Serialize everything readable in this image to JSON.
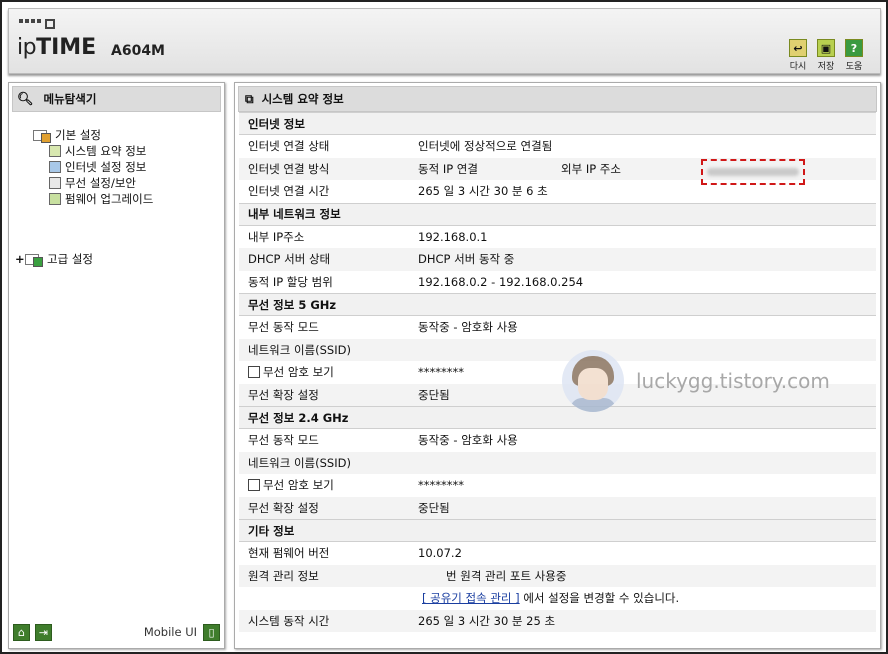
{
  "header": {
    "brand_prefix": "ip",
    "brand_main": "TIME",
    "model": "A604M",
    "tools": [
      {
        "label": "다시",
        "icon": "refresh-icon",
        "color": "#e0d070"
      },
      {
        "label": "저장",
        "icon": "save-icon",
        "color": "#b8d050"
      },
      {
        "label": "도움",
        "icon": "help-icon",
        "color": "#3a9a40"
      }
    ]
  },
  "sidebar": {
    "title": "메뉴탐색기",
    "basic": {
      "label": "기본 설정",
      "items": [
        {
          "label": "시스템 요약 정보",
          "icon": "chart-icon"
        },
        {
          "label": "인터넷 설정 정보",
          "icon": "monitor-icon"
        },
        {
          "label": "무선 설정/보안",
          "icon": "wireless-icon"
        },
        {
          "label": "펌웨어 업그레이드",
          "icon": "upgrade-icon"
        }
      ]
    },
    "advanced": {
      "expander": "+",
      "label": "고급 설정"
    },
    "footer": {
      "mobile_label": "Mobile UI"
    }
  },
  "main": {
    "title": "시스템 요약 정보",
    "internet": {
      "heading": "인터넷 정보",
      "status_label": "인터넷 연결 상태",
      "status_value": "인터넷에 정상적으로 연결됨",
      "method_label": "인터넷 연결 방식",
      "method_value": "동적 IP 연결",
      "external_ip_label": "외부 IP 주소",
      "uptime_label": "인터넷 연결 시간",
      "uptime_value": "265 일 3 시간 30 분 6 초"
    },
    "lan": {
      "heading": "내부 네트워크 정보",
      "ip_label": "내부 IP주소",
      "ip_value": "192.168.0.1",
      "dhcp_label": "DHCP 서버 상태",
      "dhcp_value": "DHCP 서버 동작 중",
      "range_label": "동적 IP 할당 범위",
      "range_value": "192.168.0.2 -  192.168.0.254"
    },
    "wifi5": {
      "heading": "무선 정보 5 GHz",
      "mode_label": "무선 동작 모드",
      "mode_value": "동작중 - 암호화 사용",
      "ssid_label": "네트워크 이름(SSID)",
      "pw_label": "무선 암호 보기",
      "pw_value": "********",
      "ext_label": "무선 확장 설정",
      "ext_value": "중단됨"
    },
    "wifi24": {
      "heading": "무선 정보 2.4 GHz",
      "mode_label": "무선 동작 모드",
      "mode_value": "동작중 - 암호화 사용",
      "ssid_label": "네트워크 이름(SSID)",
      "pw_label": "무선 암호 보기",
      "pw_value": "********",
      "ext_label": "무선 확장 설정",
      "ext_value": "중단됨"
    },
    "etc": {
      "heading": "기타 정보",
      "fw_label": "현재 펌웨어 버전",
      "fw_value": "10.07.2",
      "remote_label": "원격 관리 정보",
      "remote_value": "번 원격 관리 포트 사용중",
      "remote_link": "[ 공유기 접속 관리 ]",
      "remote_note": "에서 설정을 변경할 수 있습니다.",
      "sys_uptime_label": "시스템 동작 시간",
      "sys_uptime_value": "265 일 3 시간 30 분 25 초"
    }
  },
  "watermark": {
    "text": "luckygg.tistory.com"
  },
  "colors": {
    "accent_green": "#3f7d2c",
    "highlight_red": "#d01818"
  }
}
